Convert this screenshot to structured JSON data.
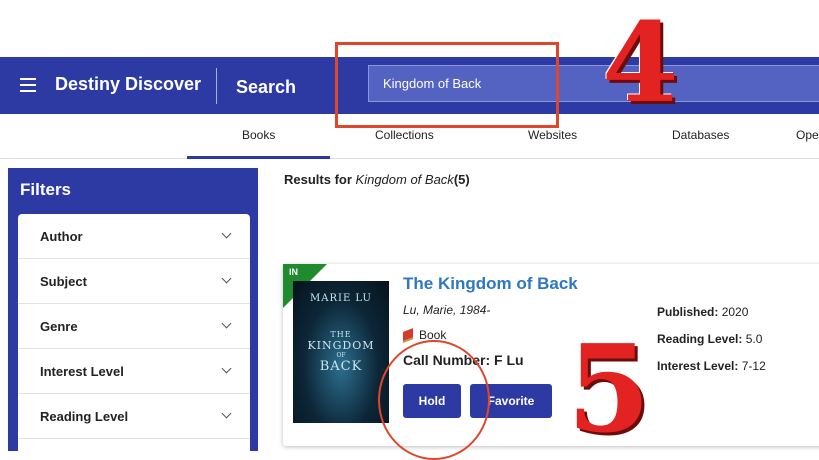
{
  "header": {
    "brand": "Destiny Discover",
    "section": "Search",
    "search_value": "Kingdom of Back"
  },
  "tabs": [
    {
      "label": "Books",
      "active": true
    },
    {
      "label": "Collections",
      "active": false
    },
    {
      "label": "Websites",
      "active": false
    },
    {
      "label": "Databases",
      "active": false
    },
    {
      "label": "Ope",
      "active": false
    }
  ],
  "filters": {
    "title": "Filters",
    "items": [
      {
        "label": "Author"
      },
      {
        "label": "Subject"
      },
      {
        "label": "Genre"
      },
      {
        "label": "Interest Level"
      },
      {
        "label": "Reading Level"
      }
    ]
  },
  "results": {
    "prefix": "Results for",
    "query": "Kingdom of Back",
    "count": "(5)"
  },
  "card": {
    "availability": "IN",
    "title": "The Kingdom of Back",
    "author": "Lu, Marie, 1984-",
    "format": "Book",
    "call_number": "Call Number: F Lu",
    "hold_label": "Hold",
    "favorite_label": "Favorite",
    "published_label": "Published:",
    "published_value": "2020",
    "reading_label": "Reading Level:",
    "reading_value": "5.0",
    "interest_label": "Interest Level:",
    "interest_value": "7-12",
    "cover": {
      "author": "MARIE LU",
      "title_line1": "THE",
      "title_line2": "KINGDOM",
      "title_line3": "OF",
      "title_line4": "BACK"
    }
  },
  "annotations": {
    "step4": "4",
    "step5": "5",
    "color": "#e0462a"
  },
  "colors": {
    "primary": "#2e3aa3",
    "link": "#2f77c0",
    "available": "#1f8a2e"
  }
}
